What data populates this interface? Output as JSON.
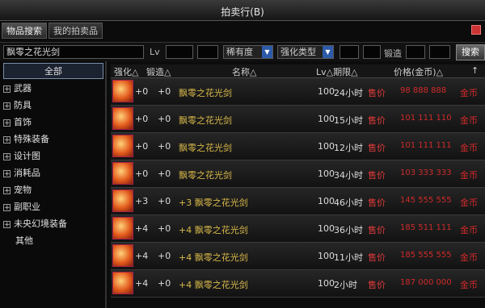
{
  "window": {
    "title": "拍卖行(B)"
  },
  "tabs": [
    {
      "label": "物品搜索",
      "active": true
    },
    {
      "label": "我的拍卖品",
      "active": false
    }
  ],
  "search": {
    "query": "飘零之花光剑",
    "lv_label": "Lv",
    "lv_min": "",
    "lv_max": "",
    "rarity_select": "稀有度",
    "type_select": "强化类型",
    "value_min": "",
    "value_max": "",
    "forge_label": "锻造",
    "forge_min": "",
    "forge_max": "",
    "search_button": "搜索"
  },
  "categories": [
    {
      "label": "全部",
      "expandable": false,
      "selected": true
    },
    {
      "label": "武器",
      "expandable": true
    },
    {
      "label": "防具",
      "expandable": true
    },
    {
      "label": "首饰",
      "expandable": true
    },
    {
      "label": "特殊装备",
      "expandable": true
    },
    {
      "label": "设计图",
      "expandable": true
    },
    {
      "label": "消耗品",
      "expandable": true
    },
    {
      "label": "宠物",
      "expandable": true
    },
    {
      "label": "副职业",
      "expandable": true
    },
    {
      "label": "未央幻境装备",
      "expandable": true
    },
    {
      "label": "其他",
      "expandable": false
    }
  ],
  "columns": {
    "enhance": "强化△",
    "forge": "锻造△",
    "name": "名称△",
    "lv_time": "Lv△期限△",
    "price": "价格(金币)△",
    "pin": "↑"
  },
  "rows": [
    {
      "enhance": "+0",
      "forge": "+0",
      "name": "飘零之花光剑",
      "lv": "100",
      "time": "24小时",
      "tag": "售价",
      "price": "98 888 888",
      "currency": "金币"
    },
    {
      "enhance": "+0",
      "forge": "+0",
      "name": "飘零之花光剑",
      "lv": "100",
      "time": "15小时",
      "tag": "售价",
      "price": "101 111 110",
      "currency": "金币"
    },
    {
      "enhance": "+0",
      "forge": "+0",
      "name": "飘零之花光剑",
      "lv": "100",
      "time": "12小时",
      "tag": "售价",
      "price": "101 111 111",
      "currency": "金币"
    },
    {
      "enhance": "+0",
      "forge": "+0",
      "name": "飘零之花光剑",
      "lv": "100",
      "time": "34小时",
      "tag": "售价",
      "price": "103 333 333",
      "currency": "金币"
    },
    {
      "enhance": "+3",
      "forge": "+0",
      "name": "+3 飘零之花光剑",
      "lv": "100",
      "time": "46小时",
      "tag": "售价",
      "price": "145 555 555",
      "currency": "金币"
    },
    {
      "enhance": "+4",
      "forge": "+0",
      "name": "+4 飘零之花光剑",
      "lv": "100",
      "time": "36小时",
      "tag": "售价",
      "price": "185 511 111",
      "currency": "金币"
    },
    {
      "enhance": "+4",
      "forge": "+0",
      "name": "+4 飘零之花光剑",
      "lv": "100",
      "time": "11小时",
      "tag": "售价",
      "price": "185 555 555",
      "currency": "金币"
    },
    {
      "enhance": "+4",
      "forge": "+0",
      "name": "+4 飘零之花光剑",
      "lv": "100",
      "time": "2小时",
      "tag": "售价",
      "price": "187 000 000",
      "currency": "金币"
    }
  ]
}
